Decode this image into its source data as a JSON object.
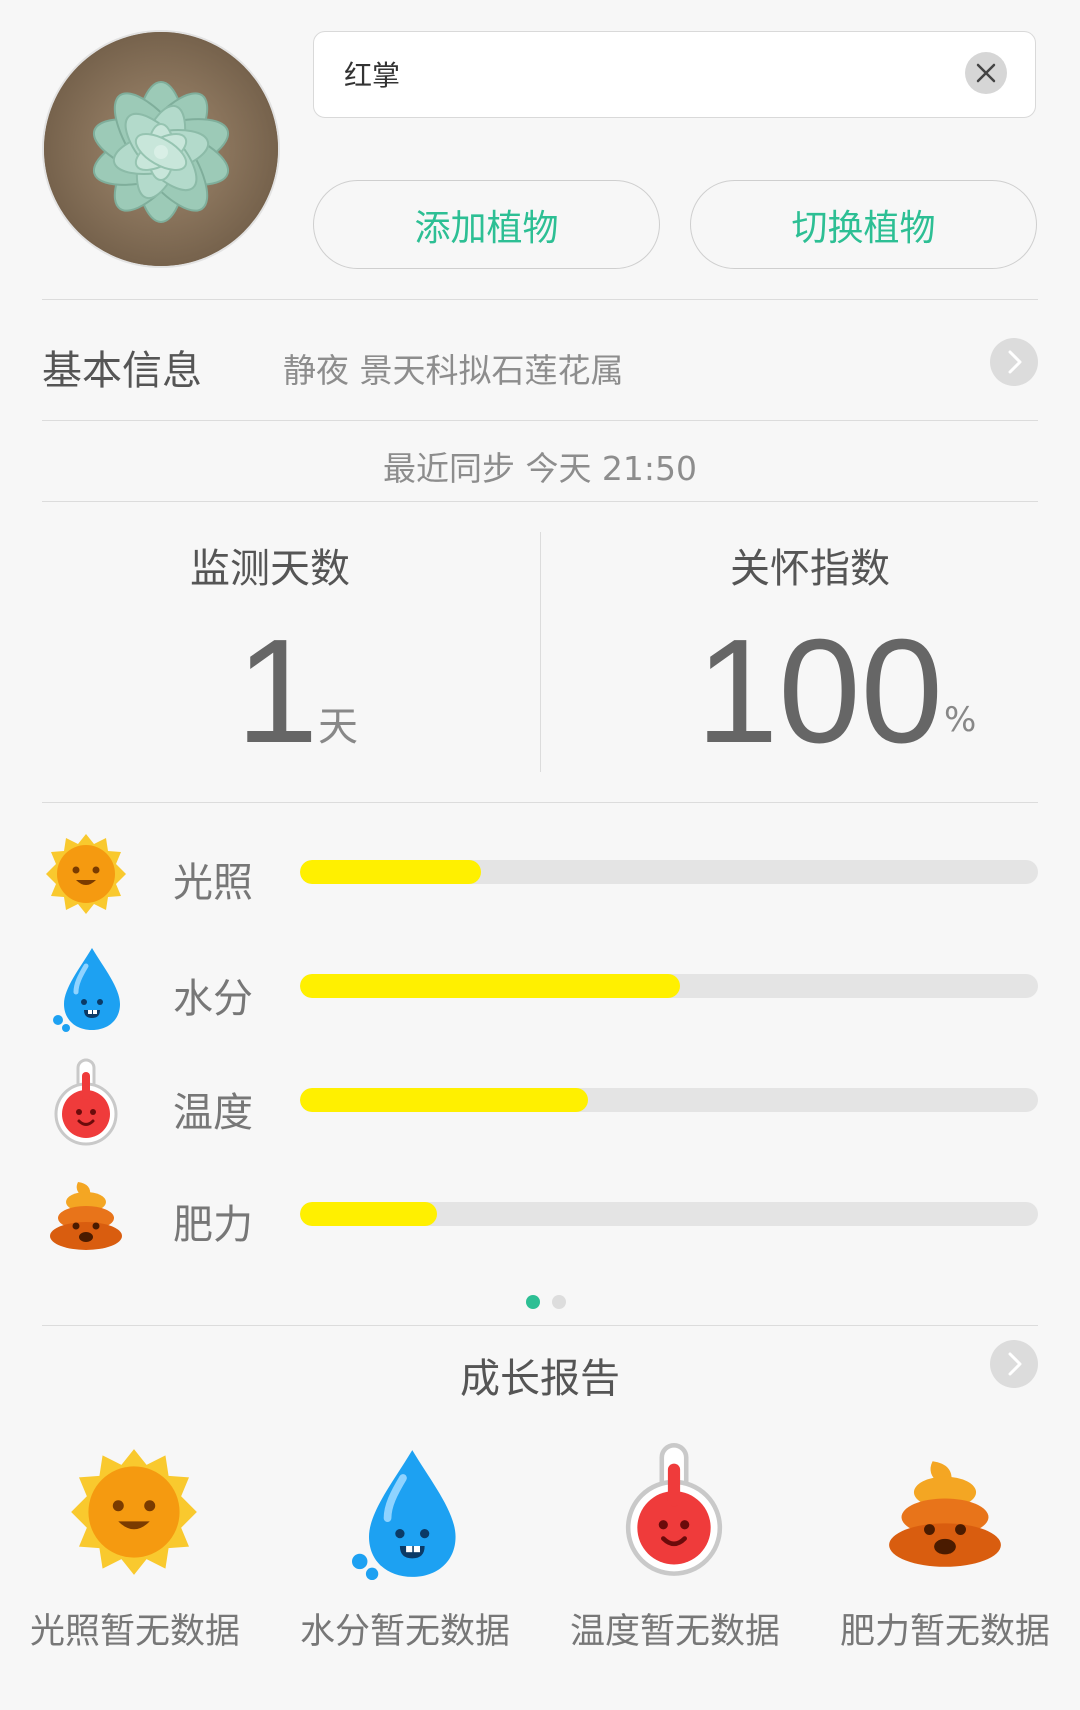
{
  "plant": {
    "name": "红掌"
  },
  "actions": {
    "add_label": "添加植物",
    "switch_label": "切换植物"
  },
  "basic_info": {
    "label": "基本信息",
    "value": "静夜 景天科拟石莲花属"
  },
  "sync": {
    "text": "最近同步 今天 21:50"
  },
  "stats": {
    "days_title": "监测天数",
    "days_value": "1",
    "days_unit": "天",
    "care_title": "关怀指数",
    "care_value": "100",
    "care_unit": "%"
  },
  "metrics": [
    {
      "label": "光照",
      "icon": "sun-icon",
      "fraction": 0.245
    },
    {
      "label": "水分",
      "icon": "water-drop-icon",
      "fraction": 0.515
    },
    {
      "label": "温度",
      "icon": "thermometer-icon",
      "fraction": 0.39
    },
    {
      "label": "肥力",
      "icon": "fertilizer-icon",
      "fraction": 0.185
    }
  ],
  "pager": {
    "total": 2,
    "active": 1
  },
  "report": {
    "title": "成长报告"
  },
  "report_items": [
    {
      "icon": "sun-icon",
      "status": "光照暂无数据"
    },
    {
      "icon": "water-drop-icon",
      "status": "水分暂无数据"
    },
    {
      "icon": "thermometer-icon",
      "status": "温度暂无数据"
    },
    {
      "icon": "fertilizer-icon",
      "status": "肥力暂无数据"
    }
  ],
  "colors": {
    "accent": "#2dbf94",
    "bar_fill": "#fff000",
    "bar_track": "#e4e4e4"
  }
}
